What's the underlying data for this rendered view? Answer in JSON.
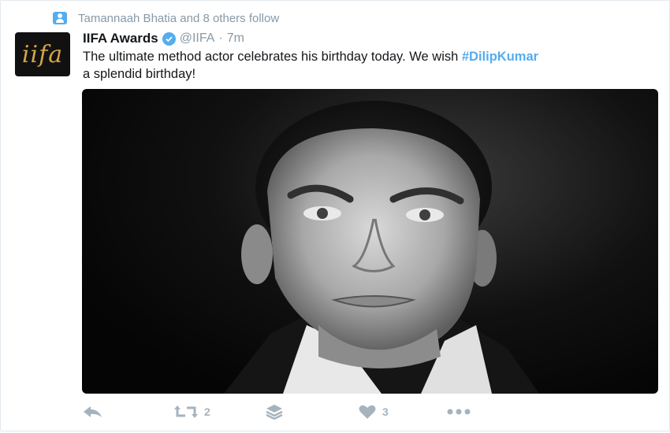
{
  "social_context": {
    "text": "Tamannaah Bhatia and 8 others follow",
    "icon": "person-icon"
  },
  "tweet": {
    "avatar_text": "iifa",
    "author_name": "IIFA Awards",
    "verified": true,
    "handle": "@IIFA",
    "separator": "·",
    "time": "7m",
    "text_part1": "The ultimate method actor celebrates his birthday today. We  wish ",
    "hashtag": "#DilipKumar",
    "text_part2": "a splendid birthday!"
  },
  "actions": {
    "reply_icon": "reply-icon",
    "retweet_icon": "retweet-icon",
    "retweet_count": "2",
    "stack_icon": "layers-icon",
    "like_icon": "heart-icon",
    "like_count": "3",
    "more_icon": "more-icon"
  },
  "colors": {
    "accent": "#55acee",
    "muted": "#8899a6",
    "action": "#a6b3bd",
    "text": "#14171a"
  }
}
